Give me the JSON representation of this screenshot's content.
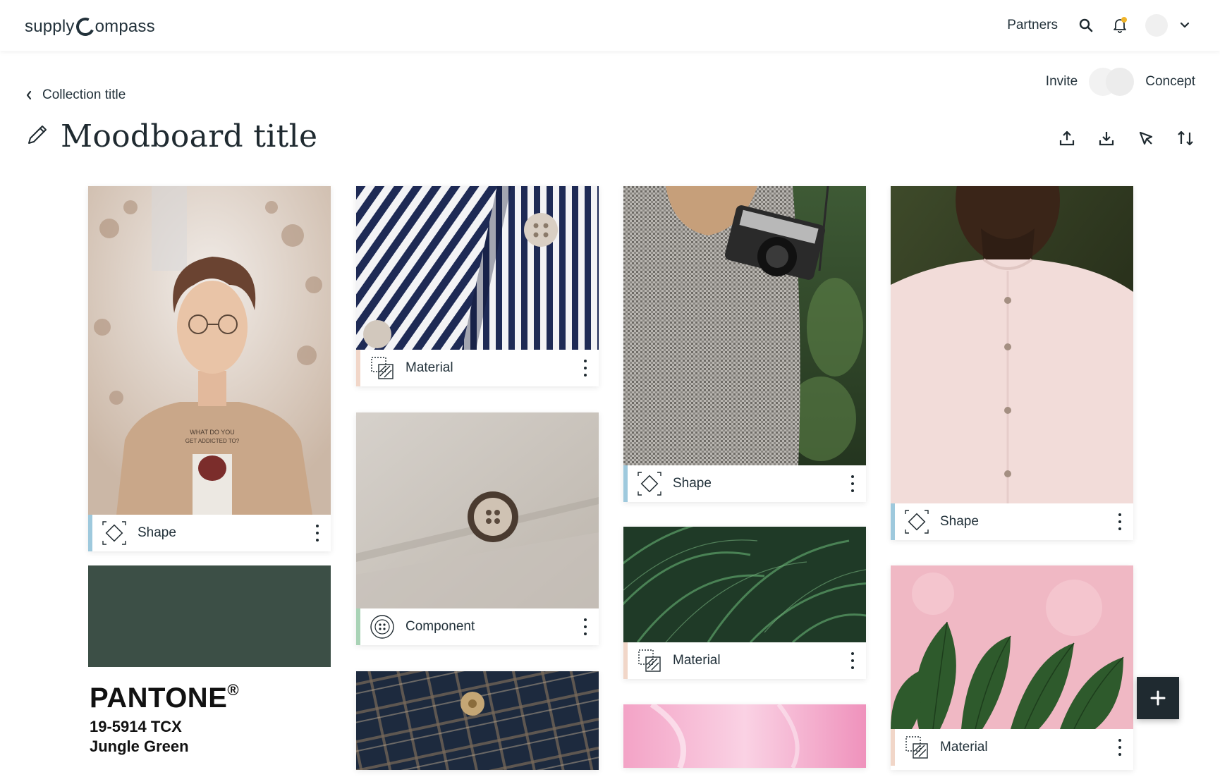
{
  "brand": {
    "logo_left": "supply",
    "logo_right": "ompass"
  },
  "topnav": {
    "partners": "Partners"
  },
  "breadcrumb": {
    "back_label": "Collection title"
  },
  "header": {
    "title": "Moodboard title",
    "invite_label": "Invite",
    "concept_label": "Concept"
  },
  "cards": {
    "c1": {
      "type_label": "Shape",
      "accent": "#9ec9dd",
      "image_colors": [
        "#e9e2dc",
        "#c9ae93",
        "#8a6a55",
        "#d8c5b2"
      ],
      "shirt_text_1": "WHAT DO YOU",
      "shirt_text_2": "GET ADDICTED TO?"
    },
    "c2": {
      "brand": "PANTONE",
      "reg": "®",
      "code": "19-5914 TCX",
      "name": "Jungle Green",
      "swatch_color": "#3c4f46"
    },
    "c3": {
      "type_label": "Material",
      "accent": "#f1d6c8"
    },
    "c4": {
      "type_label": "Component",
      "accent": "#a9d3b6"
    },
    "c5": {
      "type_label": "Shape",
      "accent": "#9ec9dd"
    },
    "c6": {
      "type_label": "Material",
      "accent": "#f1d6c8"
    },
    "c7": {
      "type_label": "Shape",
      "accent": "#9ec9dd"
    },
    "c8": {
      "type_label": "Material",
      "accent": "#f1d6c8"
    }
  },
  "icons": {
    "back": "chevron-left-icon",
    "edit": "pencil-icon",
    "search": "search-icon",
    "bell": "bell-icon",
    "caret": "chevron-down-icon",
    "upload": "upload-icon",
    "download": "download-icon",
    "select": "cursor-select-icon",
    "sort": "sort-icon",
    "add": "plus-icon"
  }
}
